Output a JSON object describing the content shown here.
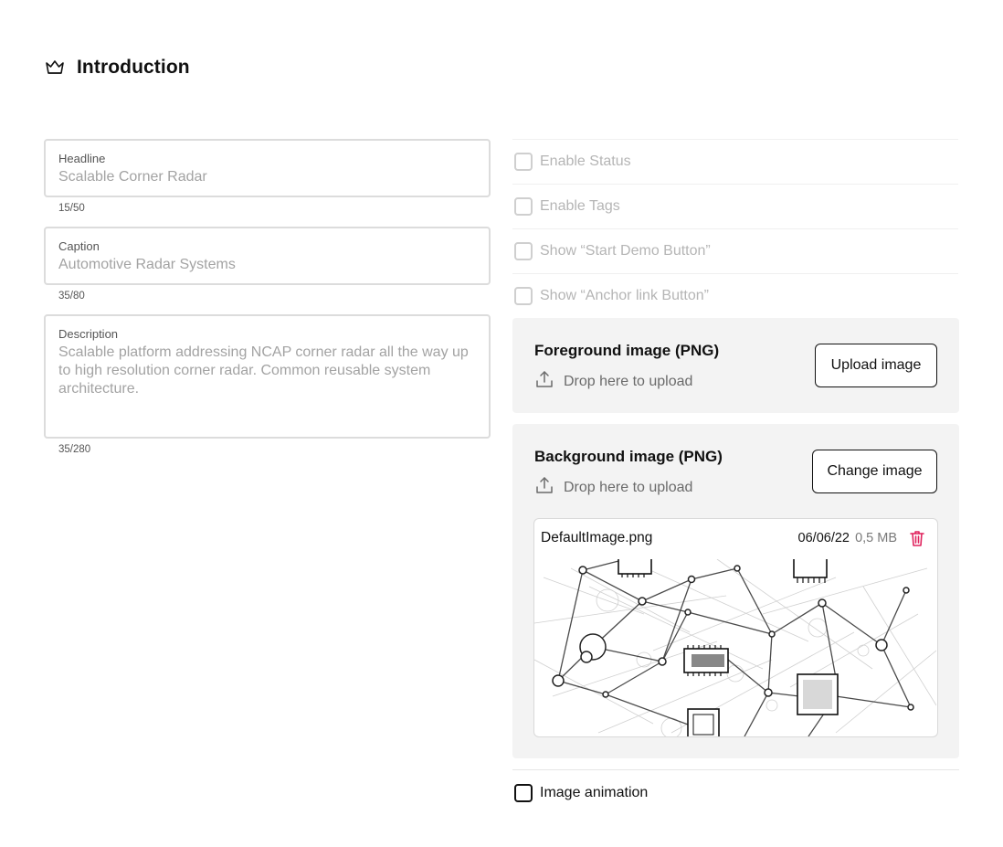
{
  "section": {
    "title": "Introduction",
    "icon": "crown-icon"
  },
  "fields": {
    "headline": {
      "label": "Headline",
      "value": "Scalable Corner Radar",
      "counter": "15/50"
    },
    "caption": {
      "label": "Caption",
      "value": "Automotive Radar Systems",
      "counter": "35/80"
    },
    "description": {
      "label": "Description",
      "value": "Scalable platform addressing NCAP corner radar all the way up to high resolution corner radar. Common reusable system architecture.",
      "counter": "35/280"
    }
  },
  "options": [
    {
      "label": "Enable Status",
      "checked": false,
      "disabled": true
    },
    {
      "label": "Enable Tags",
      "checked": false,
      "disabled": true
    },
    {
      "label": "Show “Start Demo Button”",
      "checked": false,
      "disabled": true
    },
    {
      "label": "Show “Anchor link Button”",
      "checked": false,
      "disabled": true
    }
  ],
  "foreground": {
    "title": "Foreground image (PNG)",
    "drop_text": "Drop here to upload",
    "button_label": "Upload image"
  },
  "background": {
    "title": "Background image (PNG)",
    "drop_text": "Drop here to upload",
    "button_label": "Change image",
    "file": {
      "name": "DefaultImage.png",
      "date": "06/06/22",
      "size": "0,5 MB"
    }
  },
  "image_animation": {
    "label": "Image animation",
    "checked": false
  },
  "colors": {
    "accent_delete": "#e0245e",
    "panel_bg": "#f3f3f3",
    "muted_text": "#a3a3a3"
  }
}
